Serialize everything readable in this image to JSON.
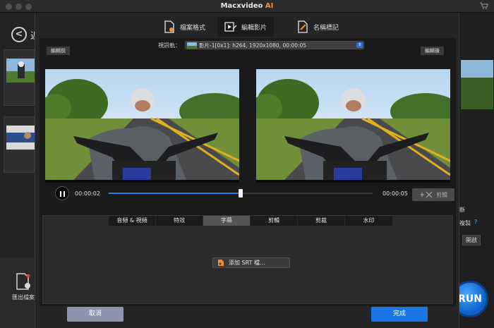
{
  "app": {
    "title_main": "Macxvideo",
    "title_suffix": " AI"
  },
  "background": {
    "back_label": "返",
    "export_label": "匯出檔案格",
    "run_label": "RUN",
    "right_snippets": {
      "a": "斷",
      "b": "複製",
      "c": "?",
      "d": "開啟"
    }
  },
  "dialog": {
    "tabs": [
      {
        "label": "檔案格式"
      },
      {
        "label": "編輯影片"
      },
      {
        "label": "名稱標記"
      }
    ],
    "track": {
      "label": "視訊軌：",
      "value": "影片-1[0x1]: h264, 1920x1080, 00:00:05"
    },
    "before_label": "編輯前",
    "after_label": "編輯後",
    "player": {
      "current_time": "00:00:02",
      "total_time": "00:00:05",
      "progress": 0.5,
      "cut_label": "剪輯"
    },
    "subtabs": [
      {
        "label": "音頻 & 視頻"
      },
      {
        "label": "特效"
      },
      {
        "label": "字幕"
      },
      {
        "label": "剪輯"
      },
      {
        "label": "剪裁"
      },
      {
        "label": "水印"
      }
    ],
    "add_srt_label": "添加 SRT 檔...",
    "cancel_label": "取消",
    "done_label": "完成"
  },
  "colors": {
    "accent": "#1a76e2",
    "brand_ai": "#f0923a"
  }
}
